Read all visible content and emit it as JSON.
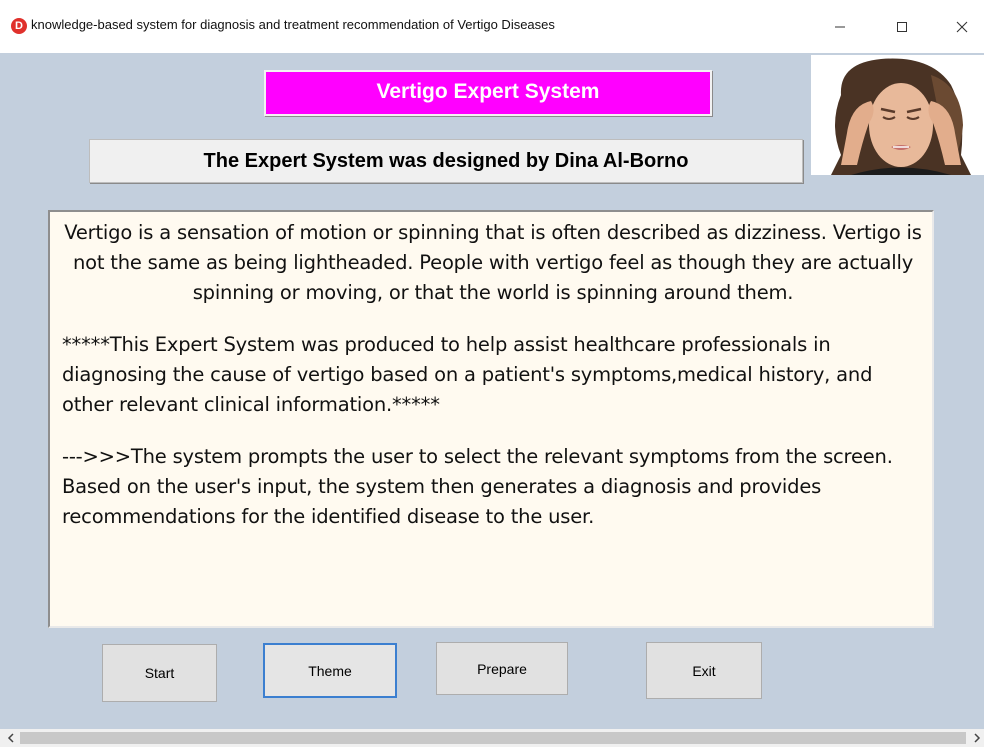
{
  "window": {
    "title": "knowledge-based system for diagnosis and treatment recommendation of Vertigo Diseases",
    "app_icon_letter": "D",
    "app_icon_color": "#e0312c"
  },
  "header": {
    "title": "Vertigo Expert System",
    "title_bg": "#ff00ff",
    "designer": "The Expert System was designed by Dina Al-Borno"
  },
  "description": {
    "paragraphs": [
      "Vertigo is a sensation of motion or spinning that is often described as dizziness. Vertigo is not the same as being lightheaded. People with vertigo feel as though they are actually spinning or moving, or that the world is spinning around them.",
      "*****This Expert System was produced to help assist healthcare professionals in diagnosing the cause of vertigo based on a patient's symptoms,medical history, and other relevant clinical information.*****",
      "--->>>The system prompts the user to select the relevant symptoms from the screen. Based on the user's input, the system then generates a diagnosis and provides recommendations for the identified disease to the user."
    ]
  },
  "buttons": {
    "start": "Start",
    "theme": "Theme",
    "prepare": "Prepare",
    "exit": "Exit"
  },
  "icons": {
    "minimize": "minimize-icon",
    "maximize": "maximize-icon",
    "close": "close-icon",
    "scroll_left": "chevron-left-icon",
    "scroll_right": "chevron-right-icon"
  }
}
